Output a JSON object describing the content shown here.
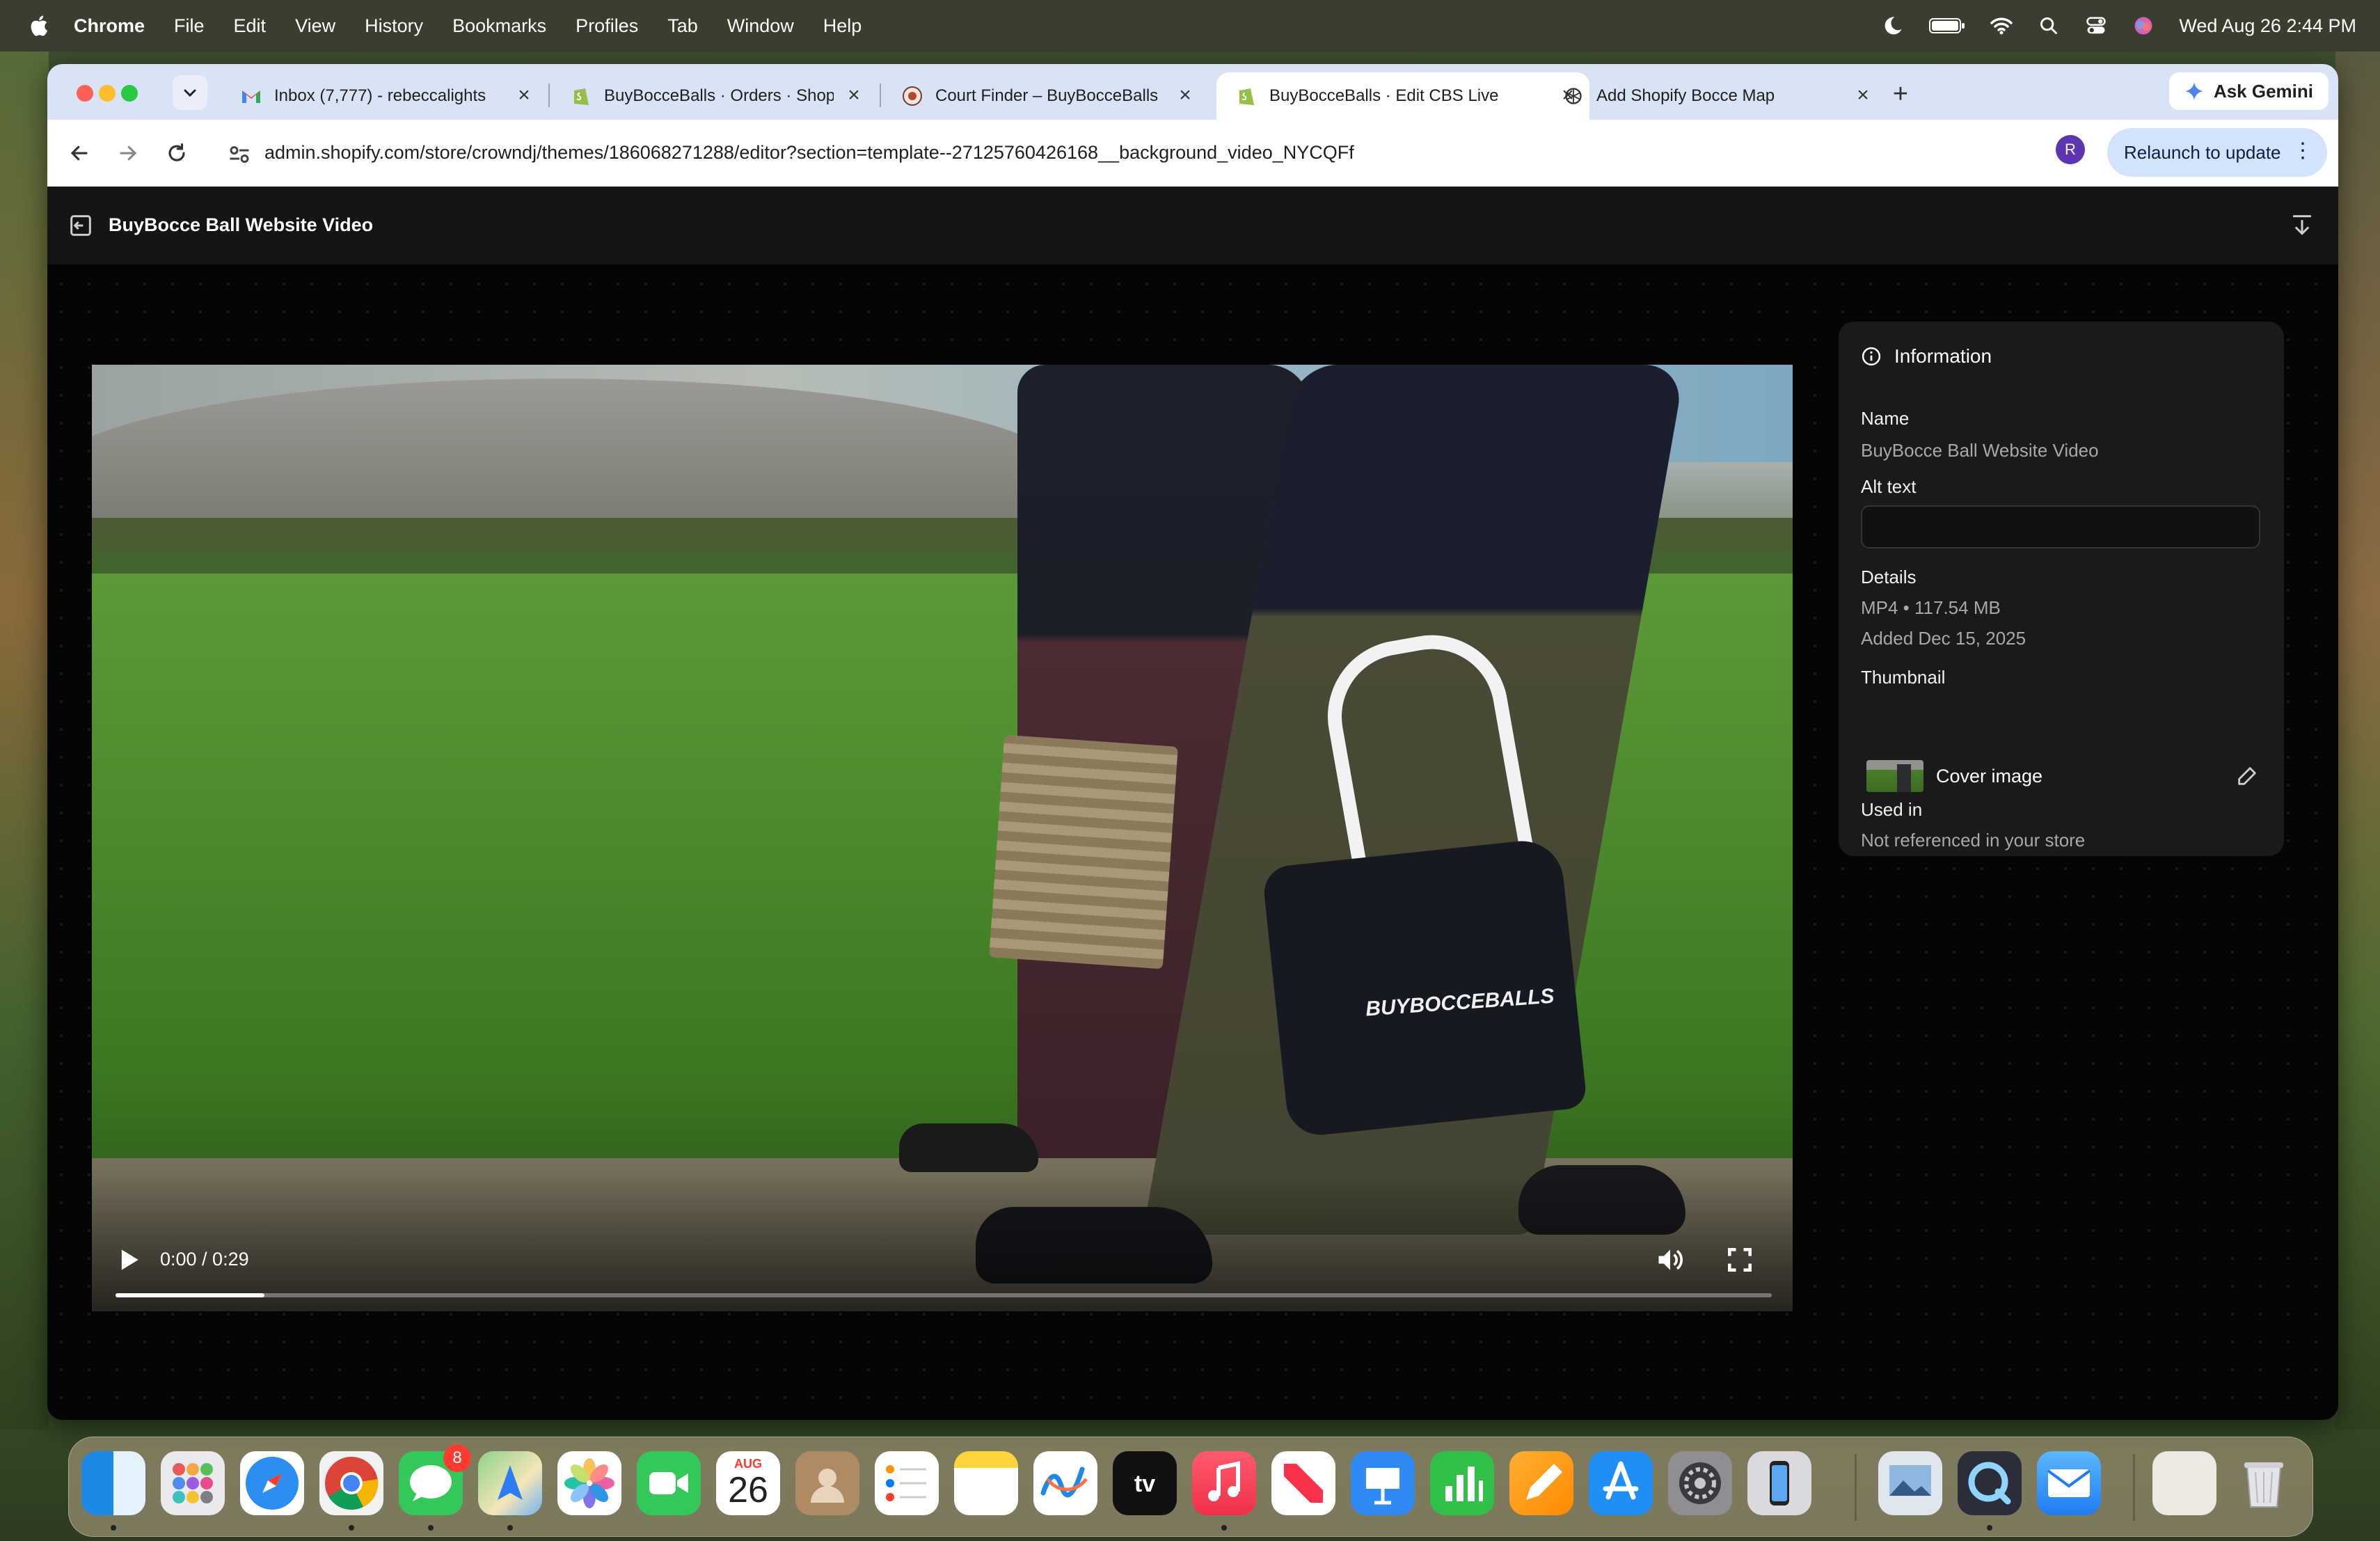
{
  "menubar": {
    "app": "Chrome",
    "items": [
      "File",
      "Edit",
      "View",
      "History",
      "Bookmarks",
      "Profiles",
      "Tab",
      "Window",
      "Help"
    ],
    "clock": "Wed Aug 26  2:44 PM"
  },
  "tabs": [
    {
      "label": "Inbox (7,777) - rebeccalights",
      "favicon": "gmail-icon",
      "active": false
    },
    {
      "label": "BuyBocceBalls · Orders · Shop",
      "favicon": "shopify-icon",
      "active": false
    },
    {
      "label": "Court Finder – BuyBocceBalls",
      "favicon": "court-finder-icon",
      "active": false
    },
    {
      "label": "BuyBocceBalls · Edit CBS Live",
      "favicon": "shopify-icon",
      "active": true
    },
    {
      "label": "Add Shopify Bocce Map",
      "favicon": "openai-icon",
      "active": false
    }
  ],
  "gemini_label": "Ask Gemini",
  "address_bar": {
    "url": "admin.shopify.com/store/crowndj/themes/186068271288/editor?section=template--27125760426168__background_video_NYCQFf"
  },
  "avatar_letter": "R",
  "relaunch_label": "Relaunch to update",
  "page": {
    "title": "BuyBocce Ball Website Video"
  },
  "video": {
    "time": "0:00 / 0:29",
    "progress": 0.09,
    "bag_text": "BUYBOCCEBALLS"
  },
  "info_panel": {
    "heading": "Information",
    "name_label": "Name",
    "name_value": "BuyBocce Ball Website Video",
    "alt_label": "Alt text",
    "alt_value": "",
    "details_label": "Details",
    "details_format": "MP4 • 117.54 MB",
    "details_added": "Added Dec 15, 2025",
    "thumbnail_label": "Thumbnail",
    "thumbnail_name": "Cover image",
    "used_in_label": "Used in",
    "used_in_value": "Not referenced in your store"
  },
  "dock": {
    "messages_badge": "8",
    "calendar_month": "AUG",
    "calendar_day": "26",
    "apps": [
      "Finder",
      "Launchpad",
      "Safari",
      "Chrome",
      "Messages",
      "Maps",
      "Photos",
      "FaceTime",
      "Calendar",
      "Contacts",
      "Reminders",
      "Notes",
      "Freeform",
      "TV",
      "Music",
      "News",
      "Keynote",
      "Numbers",
      "Pages",
      "App Store",
      "System Settings",
      "iPhone Mirroring",
      "Preview",
      "QuickTime Player",
      "Mail",
      "Downloads",
      "Trash"
    ]
  }
}
